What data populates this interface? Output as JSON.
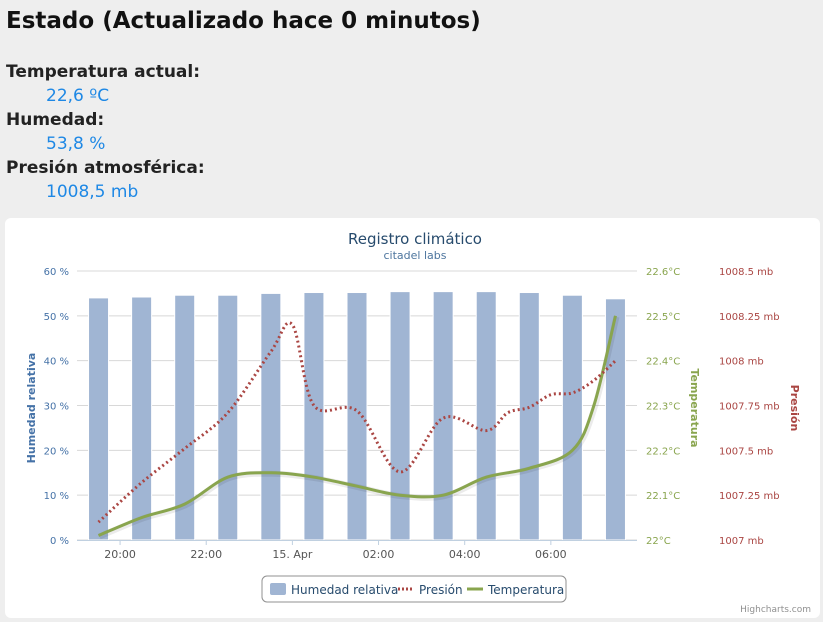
{
  "status": {
    "title": "Estado (Actualizado hace 0 minutos)"
  },
  "readings": [
    {
      "label": "Temperatura actual:",
      "value": "22,6 ºC"
    },
    {
      "label": "Humedad:",
      "value": "53,8 %"
    },
    {
      "label": "Presión atmosférica:",
      "value": "1008,5 mb"
    }
  ],
  "chart_data": {
    "type": "bar",
    "title": "Registro climático",
    "subtitle": "citadel labs",
    "credits": "Highcharts.com",
    "x_tick_labels": [
      "20:00",
      "22:00",
      "15. Apr",
      "02:00",
      "04:00",
      "06:00"
    ],
    "x": [
      "19:30",
      "20:30",
      "21:30",
      "22:30",
      "23:30",
      "00:30",
      "01:30",
      "02:30",
      "03:30",
      "04:30",
      "05:30",
      "06:30",
      "07:30"
    ],
    "legend_position": "bottom-center",
    "grid": true,
    "axes": {
      "humidity": {
        "title": "Humedad relativa",
        "ticks": [
          "0 %",
          "10 %",
          "20 %",
          "30 %",
          "40 %",
          "50 %",
          "60 %"
        ],
        "min": 0,
        "max": 60,
        "color": "#4572a7"
      },
      "temperature": {
        "title": "Temperatura",
        "ticks": [
          "22°C",
          "22.1°C",
          "22.2°C",
          "22.3°C",
          "22.4°C",
          "22.5°C",
          "22.6°C"
        ],
        "min": 22,
        "max": 22.6,
        "color": "#89a54e"
      },
      "pressure": {
        "title": "Presión",
        "ticks": [
          "1007 mb",
          "1007.25 mb",
          "1007.5 mb",
          "1007.75 mb",
          "1008 mb",
          "1008.25 mb",
          "1008.5 mb"
        ],
        "min": 1007,
        "max": 1008.5,
        "color": "#aa4643"
      }
    },
    "series": [
      {
        "name": "Humedad relativa",
        "type": "column",
        "axis": "humidity",
        "color": "#a0b5d3",
        "values": [
          54.0,
          54.2,
          54.6,
          54.6,
          55.0,
          55.2,
          55.2,
          55.4,
          55.4,
          55.4,
          55.2,
          54.6,
          53.8
        ]
      },
      {
        "name": "Presión",
        "type": "dotted-line",
        "axis": "pressure",
        "color": "#aa4643",
        "x": [
          0,
          1,
          2,
          3,
          4,
          4.5,
          5,
          6,
          7,
          8,
          9,
          9.5,
          10,
          10.5,
          11,
          11.5,
          12
        ],
        "values": [
          1007.1,
          1007.32,
          1007.51,
          1007.71,
          1008.05,
          1008.2,
          1007.75,
          1007.72,
          1007.38,
          1007.68,
          1007.61,
          1007.71,
          1007.74,
          1007.81,
          1007.82,
          1007.89,
          1008.0
        ]
      },
      {
        "name": "Temperatura",
        "type": "line",
        "axis": "temperature",
        "color": "#89a54e",
        "x": [
          0,
          1,
          2,
          3,
          4,
          5,
          6,
          7,
          8,
          9,
          10,
          11,
          11.5,
          12
        ],
        "values": [
          22.01,
          22.05,
          22.08,
          22.14,
          22.15,
          22.14,
          22.12,
          22.1,
          22.1,
          22.14,
          22.16,
          22.2,
          22.3,
          22.5
        ]
      }
    ]
  }
}
